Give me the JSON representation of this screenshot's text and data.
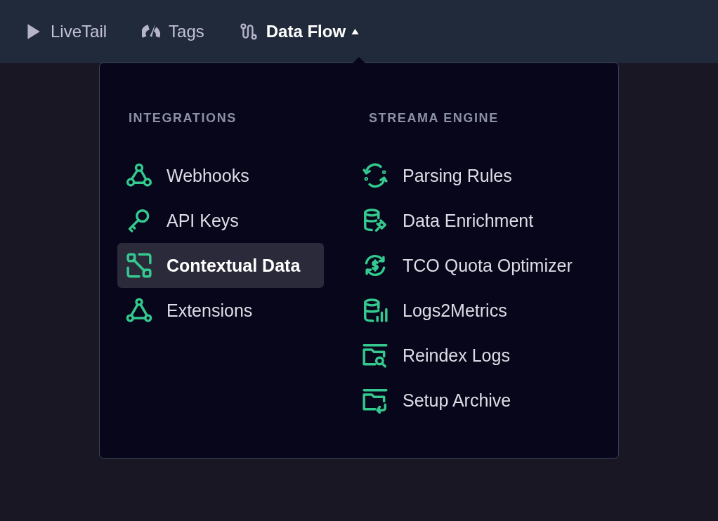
{
  "nav": [
    {
      "label": "LiveTail",
      "kind": "play",
      "selected": false,
      "expanded": false
    },
    {
      "label": "Tags",
      "kind": "gauge",
      "selected": false,
      "expanded": false
    },
    {
      "label": "Data Flow",
      "kind": "flow",
      "selected": true,
      "expanded": true
    }
  ],
  "menu": {
    "columns": [
      {
        "heading": "INTEGRATIONS",
        "items": [
          {
            "label": "Webhooks",
            "kind": "webhook",
            "selected": false
          },
          {
            "label": "API Keys",
            "kind": "key",
            "selected": false
          },
          {
            "label": "Contextual Data",
            "kind": "connect",
            "selected": true
          },
          {
            "label": "Extensions",
            "kind": "triad",
            "selected": false
          }
        ]
      },
      {
        "heading": "STREAMA ENGINE",
        "items": [
          {
            "label": "Parsing Rules",
            "kind": "cycle",
            "selected": false
          },
          {
            "label": "Data Enrichment",
            "kind": "dbplug",
            "selected": false
          },
          {
            "label": "TCO Quota Optimizer",
            "kind": "dollar",
            "selected": false
          },
          {
            "label": "Logs2Metrics",
            "kind": "dbbars",
            "selected": false
          },
          {
            "label": "Reindex Logs",
            "kind": "foldersearch",
            "selected": false
          },
          {
            "label": "Setup Archive",
            "kind": "folderreturn",
            "selected": false
          }
        ]
      }
    ]
  }
}
